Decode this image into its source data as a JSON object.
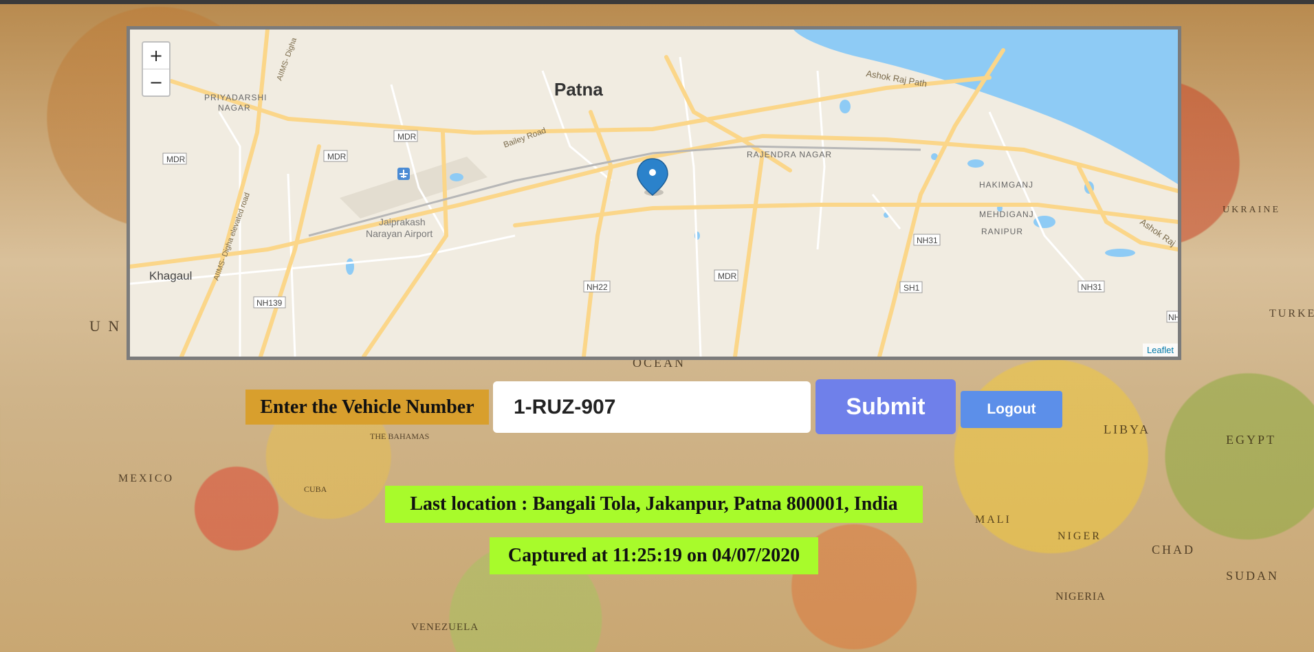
{
  "background": {
    "labels": [
      "U N",
      "OCEAN",
      "MEXICO",
      "THE BAHAMAS",
      "CUBA",
      "VENEZUELA",
      "LIBYA",
      "EGYPT",
      "MALI",
      "NIGER",
      "CHAD",
      "SUDAN",
      "NIGERIA",
      "UKRAINE",
      "TURKEY"
    ]
  },
  "map": {
    "zoom_in_label": "+",
    "zoom_out_label": "−",
    "attribution": "Leaflet",
    "place_labels": {
      "city": "Patna",
      "priyadarshi": "PRIYADARSHI",
      "nagar": "NAGAR",
      "aiims": "AIIMS- Digha",
      "aiims_elevated": "AIIMS- Digha elevated road",
      "bailey": "Bailey Road",
      "ashok": "Ashok Raj Path",
      "ashok2": "Ashok Raj",
      "rajendra": "RAJENDRA NAGAR",
      "hakimganj": "HAKIMGANJ",
      "mehdiganj": "MEHDIGANJ",
      "ranipur": "RANIPUR",
      "airport1": "Jaiprakash",
      "airport2": "Narayan Airport",
      "khagaul": "Khagaul"
    },
    "road_shields": {
      "mdr1": "MDR",
      "mdr2": "MDR",
      "mdr3": "MDR",
      "mdr4": "MDR",
      "nh31a": "NH31",
      "nh31b": "NH31",
      "nh22": "NH22",
      "sh1": "SH1",
      "nh139": "NH139",
      "nh_edge": "NH"
    },
    "colors": {
      "land": "#f1ece1",
      "water": "#8ecbf5",
      "road": "#fbd689",
      "marker": "#2b82cb"
    }
  },
  "form": {
    "label": "Enter the Vehicle Number",
    "vehicle_number": "1-RUZ-907",
    "submit_label": "Submit",
    "logout_label": "Logout"
  },
  "result": {
    "last_location": "Last location : Bangali Tola, Jakanpur, Patna 800001, India",
    "captured": "Captured at 11:25:19 on 04/07/2020"
  }
}
